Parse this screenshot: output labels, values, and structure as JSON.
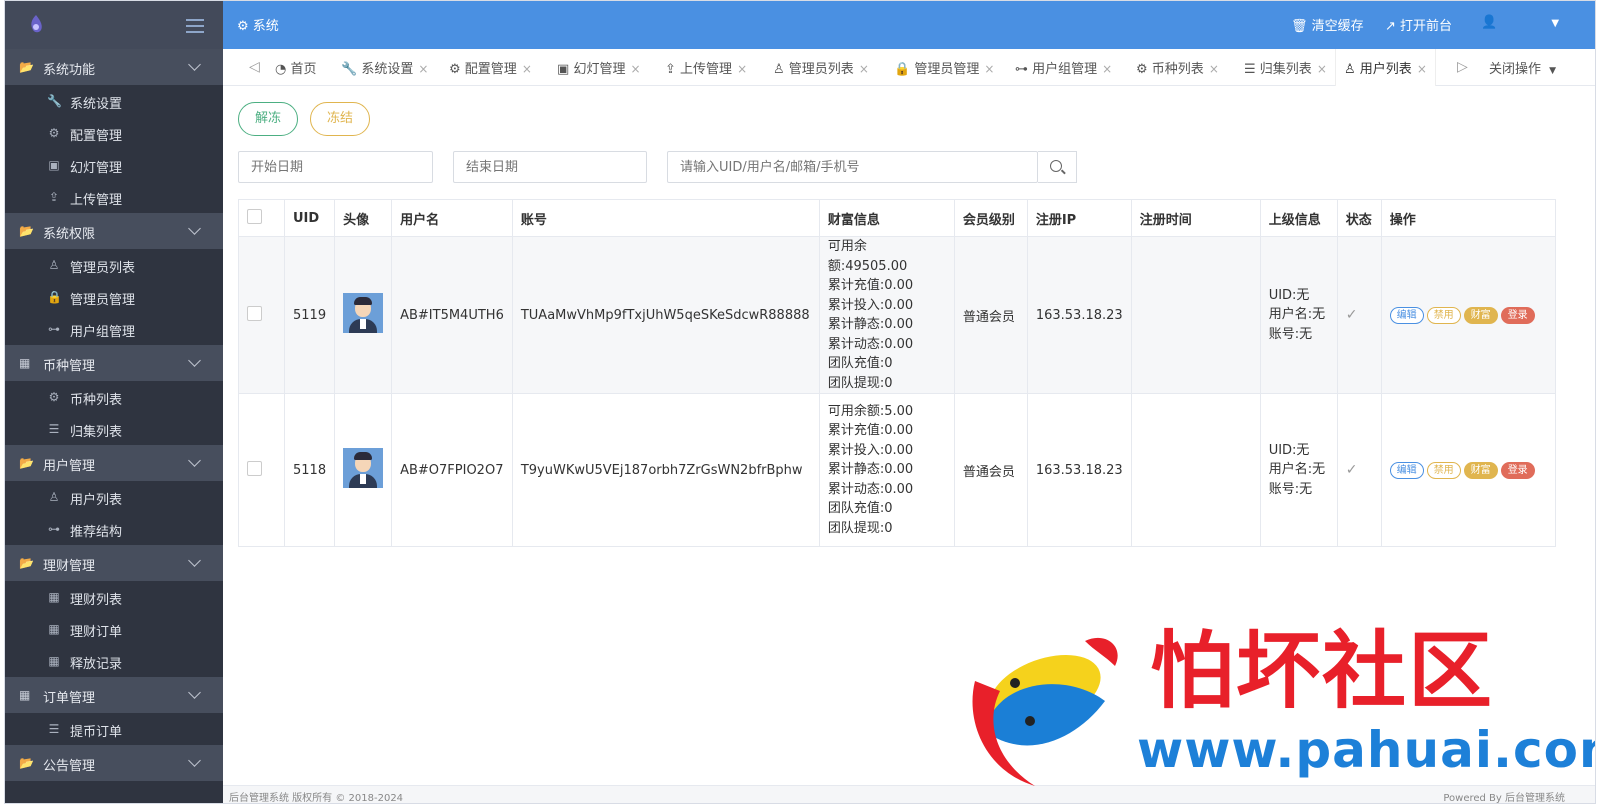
{
  "header": {
    "title": "系统",
    "clear_cache": "清空缓存",
    "open_frontend": "打开前台"
  },
  "sidebar": {
    "groups": [
      {
        "label": "系统功能",
        "items": [
          {
            "label": "系统设置",
            "icon": "wrench-icon"
          },
          {
            "label": "配置管理",
            "icon": "gears-icon"
          },
          {
            "label": "幻灯管理",
            "icon": "image-icon"
          },
          {
            "label": "上传管理",
            "icon": "upload-icon"
          }
        ]
      },
      {
        "label": "系统权限",
        "items": [
          {
            "label": "管理员列表",
            "icon": "user-icon"
          },
          {
            "label": "管理员管理",
            "icon": "lock-icon"
          },
          {
            "label": "用户组管理",
            "icon": "sitemap-icon"
          }
        ]
      },
      {
        "label": "币种管理",
        "items": [
          {
            "label": "币种列表",
            "icon": "gears-icon"
          },
          {
            "label": "归集列表",
            "icon": "list-icon"
          }
        ]
      },
      {
        "label": "用户管理",
        "items": [
          {
            "label": "用户列表",
            "icon": "user-icon"
          },
          {
            "label": "推荐结构",
            "icon": "sitemap-icon"
          }
        ]
      },
      {
        "label": "理财管理",
        "items": [
          {
            "label": "理财列表",
            "icon": "grid-icon"
          },
          {
            "label": "理财订单",
            "icon": "grid-icon"
          },
          {
            "label": "释放记录",
            "icon": "grid-icon"
          }
        ]
      },
      {
        "label": "订单管理",
        "items": [
          {
            "label": "提币订单",
            "icon": "list-icon"
          }
        ]
      },
      {
        "label": "公告管理",
        "items": []
      }
    ]
  },
  "tabs": {
    "home": "首页",
    "items": [
      "系统设置",
      "配置管理",
      "幻灯管理",
      "上传管理",
      "管理员列表",
      "管理员管理",
      "用户组管理",
      "币种列表",
      "归集列表",
      "用户列表"
    ],
    "active": "用户列表",
    "close_ops": "关闭操作"
  },
  "toolbar": {
    "unfreeze": "解冻",
    "freeze": "冻结",
    "start_date_placeholder": "开始日期",
    "end_date_placeholder": "结束日期",
    "search_placeholder": "请输入UID/用户名/邮箱/手机号"
  },
  "table": {
    "headers": [
      "UID",
      "头像",
      "用户名",
      "账号",
      "财富信息",
      "会员级别",
      "注册IP",
      "注册时间",
      "上级信息",
      "状态",
      "操作"
    ],
    "rows": [
      {
        "uid": "5119",
        "username": "AB#IT5M4UTH6",
        "account": "TUAaMwVhMp9fTxjUhW5qeSKeSdcwR88888",
        "wealth": [
          "可用余额:49505.00",
          "累计充值:0.00",
          "累计投入:0.00",
          "累计静态:0.00",
          "累计动态:0.00",
          "团队充值:0",
          "团队提现:0"
        ],
        "level": "普通会员",
        "ip": "163.53.18.23",
        "reg_time": "",
        "parent": [
          "UID:无",
          "用户名:无",
          "账号:无"
        ],
        "status": "✓"
      },
      {
        "uid": "5118",
        "username": "AB#O7FPIO2O7",
        "account": "T9yuWKwU5VEj187orbh7ZrGsWN2bfrBphw",
        "wealth": [
          "可用余额:5.00",
          "累计充值:0.00",
          "累计投入:0.00",
          "累计静态:0.00",
          "累计动态:0.00",
          "团队充值:0",
          "团队提现:0"
        ],
        "level": "普通会员",
        "ip": "163.53.18.23",
        "reg_time": "",
        "parent": [
          "UID:无",
          "用户名:无",
          "账号:无"
        ],
        "status": "✓"
      }
    ],
    "actions": {
      "edit": "编辑",
      "ban": "禁用",
      "wealth": "财富",
      "login": "登录"
    }
  },
  "footer": {
    "left": "后台管理系统 版权所有 © 2018-2024",
    "right": "Powered By 后台管理系统"
  },
  "watermark": {
    "title": "怕坏社区",
    "url": "www.pahuai.com"
  },
  "colors": {
    "header_bg": "#4a90e2",
    "sidebar_bg": "#2f3440",
    "sidebar_group_bg": "#474e5d",
    "unfreeze": "#4caf82",
    "freeze": "#e0b54f",
    "login": "#e06c5a"
  }
}
